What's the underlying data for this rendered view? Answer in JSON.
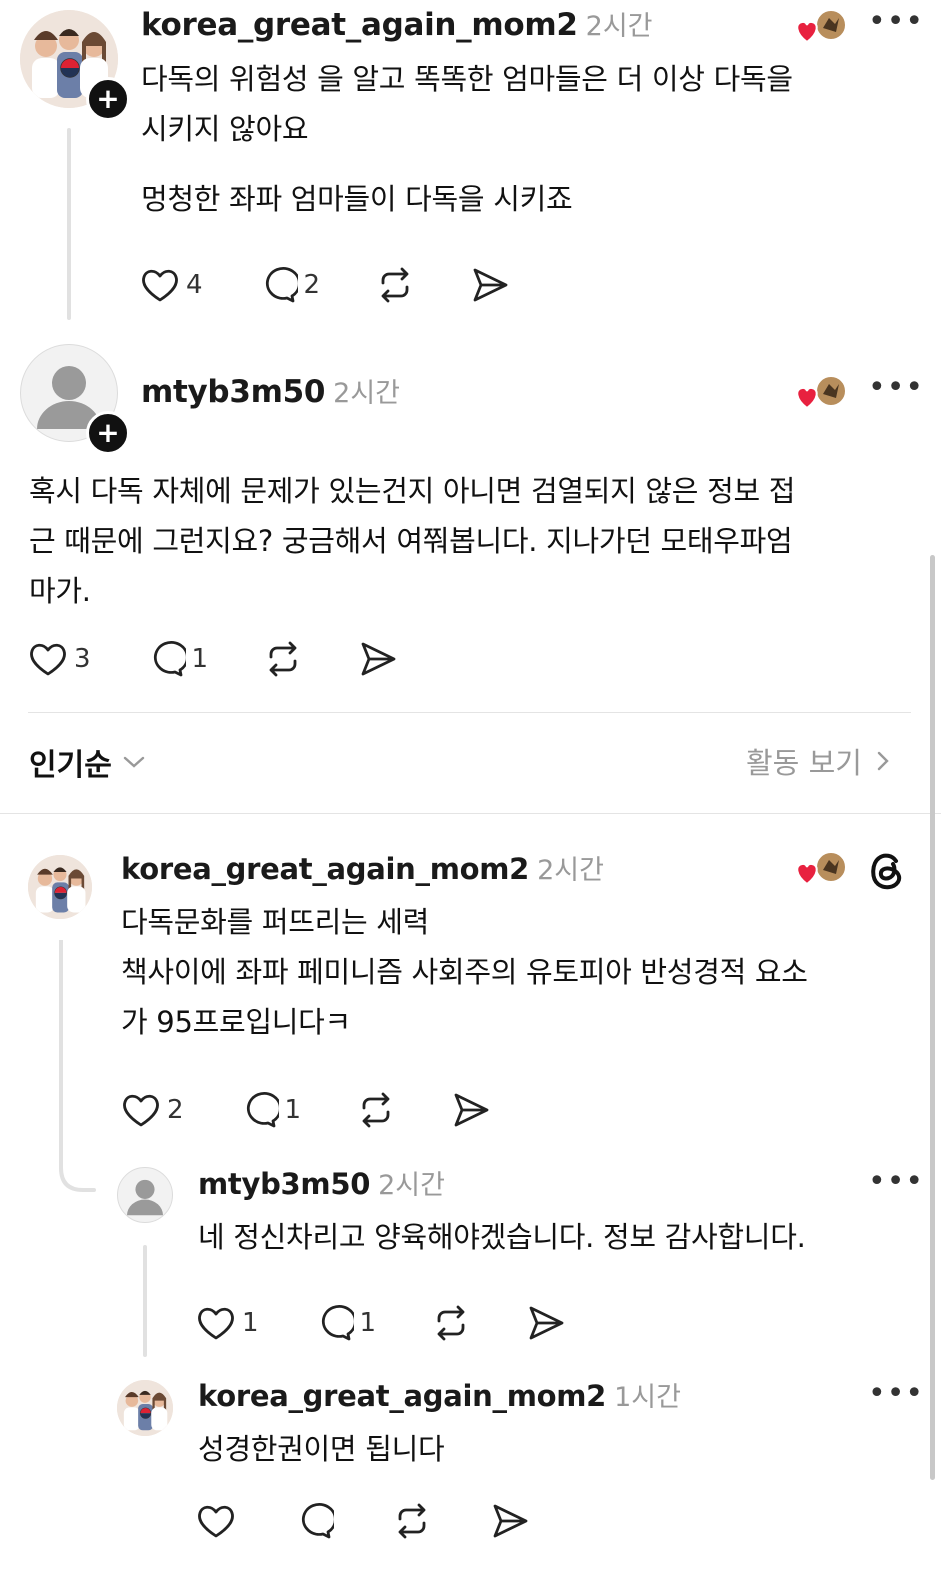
{
  "posts": [
    {
      "username": "korea_great_again_mom2",
      "time": "2시간",
      "lines": [
        "다독의 위험성 을 알고 똑똑한 엄마들은 더 이상 다독을",
        "시키지 않아요"
      ],
      "line2": "멍청한 좌파 엄마들이 다독을 시키죠",
      "likes": "4",
      "replies": "2"
    },
    {
      "username": "mtyb3m50",
      "time": "2시간",
      "lines": [
        "혹시 다독 자체에 문제가 있는건지 아니면 검열되지 않은 정보 접",
        "근 때문에 그런지요? 궁금해서 여쭤봅니다. 지나가던 모태우파엄",
        "마가."
      ],
      "likes": "3",
      "replies": "1"
    }
  ],
  "sort": {
    "label": "인기순",
    "activity_label": "활동 보기"
  },
  "comments": [
    {
      "username": "korea_great_again_mom2",
      "time": "2시간",
      "lines": [
        "다독문화를 퍼뜨리는 세력",
        "책사이에 좌파 페미니즘 사회주의 유토피아 반성경적 요소",
        "가 95프로입니다ㅋ"
      ],
      "likes": "2",
      "replies": "1"
    },
    {
      "username": "mtyb3m50",
      "time": "2시간",
      "lines": [
        "네 정신차리고 양육해야겠습니다. 정보 감사합니다."
      ],
      "likes": "1",
      "replies": "1"
    },
    {
      "username": "korea_great_again_mom2",
      "time": "1시간",
      "lines": [
        "성경한권이면 됩니다"
      ],
      "likes": "",
      "replies": ""
    }
  ],
  "colors": {
    "heart_red": "#e8213f",
    "muted": "#999999",
    "thread_line": "#e1e1e1"
  },
  "icons": [
    "heart-icon",
    "comment-icon",
    "repost-icon",
    "share-icon",
    "more-icon",
    "threads-logo-icon",
    "chevron-down-icon",
    "chevron-right-icon"
  ]
}
